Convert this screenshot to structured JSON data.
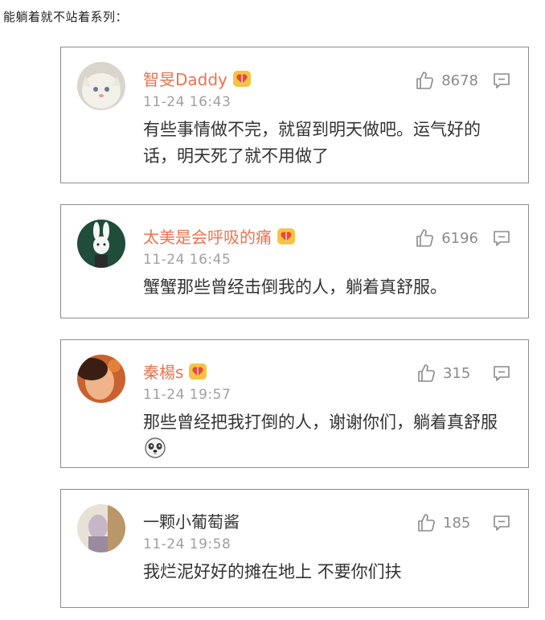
{
  "page": {
    "title": "能躺着就不站着系列："
  },
  "comments": [
    {
      "username": "智旻Daddy",
      "verified": true,
      "time": "11-24 16:43",
      "likes": "8678",
      "text": "有些事情做不完，就留到明天做吧。运气好的话，明天死了就不用做了"
    },
    {
      "username": "太美是会呼吸的痛",
      "verified": true,
      "time": "11-24 16:45",
      "likes": "6196",
      "text": "蟹蟹那些曾经击倒我的人，躺着真舒服。"
    },
    {
      "username": "秦楊s",
      "verified": true,
      "time": "11-24 19:57",
      "likes": "315",
      "text": "那些曾经把我打倒的人，谢谢你们，躺着真舒服"
    },
    {
      "username": "一颗小葡萄酱",
      "verified": false,
      "time": "11-24 19:58",
      "likes": "185",
      "text": "我烂泥好好的摊在地上 不要你们扶"
    }
  ],
  "colors": {
    "username": "#eb7350",
    "time": "#a0a0a0",
    "border": "#8c8c8c"
  },
  "icons": {
    "like": "thumbs-up-icon",
    "reply": "comment-icon",
    "badge": "vip-heart-badge-icon",
    "emoji": "dog-emoji-icon"
  }
}
